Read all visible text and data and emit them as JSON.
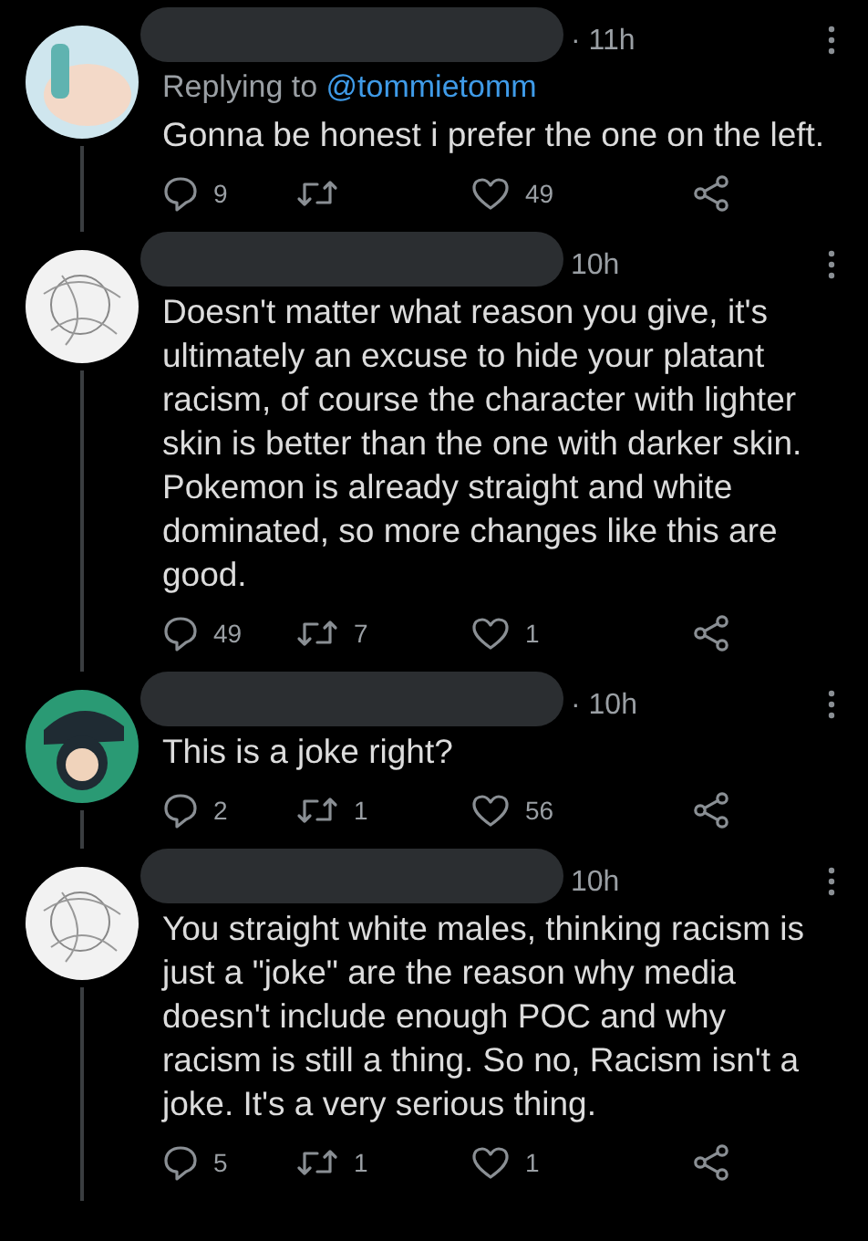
{
  "tweets": [
    {
      "time": "· 11h",
      "replying_to": {
        "prefix": "Replying to",
        "handle": "@tommietomm"
      },
      "text": "Gonna be honest i prefer the one on the left.",
      "replies": "9",
      "likes": "49"
    },
    {
      "time": "10h",
      "text": "Doesn't matter what reason you give, it's ultimately an excuse to hide your platant racism, of course the character with lighter skin is better than the one with darker skin. Pokemon is already straight and white dominated, so more changes like this are good.",
      "replies": "49",
      "retweets": "7",
      "likes": "1"
    },
    {
      "time": "· 10h",
      "text": "This is a joke right?",
      "replies": "2",
      "retweets": "1",
      "likes": "56"
    },
    {
      "time": "10h",
      "text": "You straight white males, thinking racism is just a \"joke\" are the reason why media doesn't include enough POC and why racism is still a thing. So no, Racism isn't a joke. It's a very serious thing.",
      "replies": "5",
      "retweets": "1",
      "likes": "1"
    }
  ]
}
